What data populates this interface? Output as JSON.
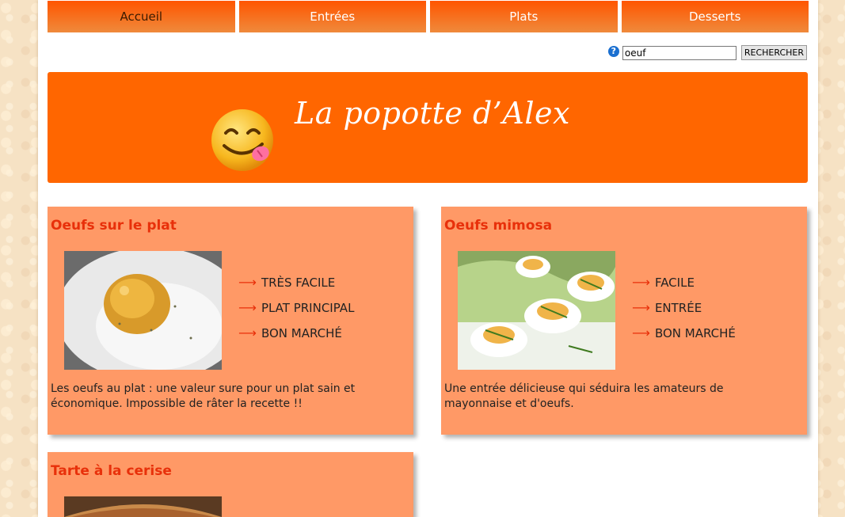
{
  "nav": {
    "items": [
      {
        "label": "Accueil"
      },
      {
        "label": "Entrées"
      },
      {
        "label": "Plats"
      },
      {
        "label": "Desserts"
      }
    ]
  },
  "search": {
    "help_icon": "?",
    "value": "oeuf",
    "button_label": "RECHERCHER"
  },
  "banner": {
    "title": "La popotte d’Alex",
    "icon": "smiley-tongue-icon"
  },
  "recipes": [
    {
      "title": "Oeufs sur le plat",
      "features": [
        "TRÈS FACILE",
        "PLAT PRINCIPAL",
        "BON MARCHÉ"
      ],
      "description": "Les oeufs au plat : une valeur sure pour un plat sain et économique. Impossible de râter la recette !!"
    },
    {
      "title": "Oeufs mimosa",
      "features": [
        "FACILE",
        "ENTRÉE",
        "BON MARCHÉ"
      ],
      "description": "Une entrée délicieuse qui séduira les amateurs de mayonnaise et d'oeufs."
    },
    {
      "title": "Tarte à la cerise"
    }
  ],
  "colors": {
    "accent": "#ff6600",
    "card": "#ff9966",
    "title": "#e8300a"
  },
  "arrow_glyph": "⟶"
}
